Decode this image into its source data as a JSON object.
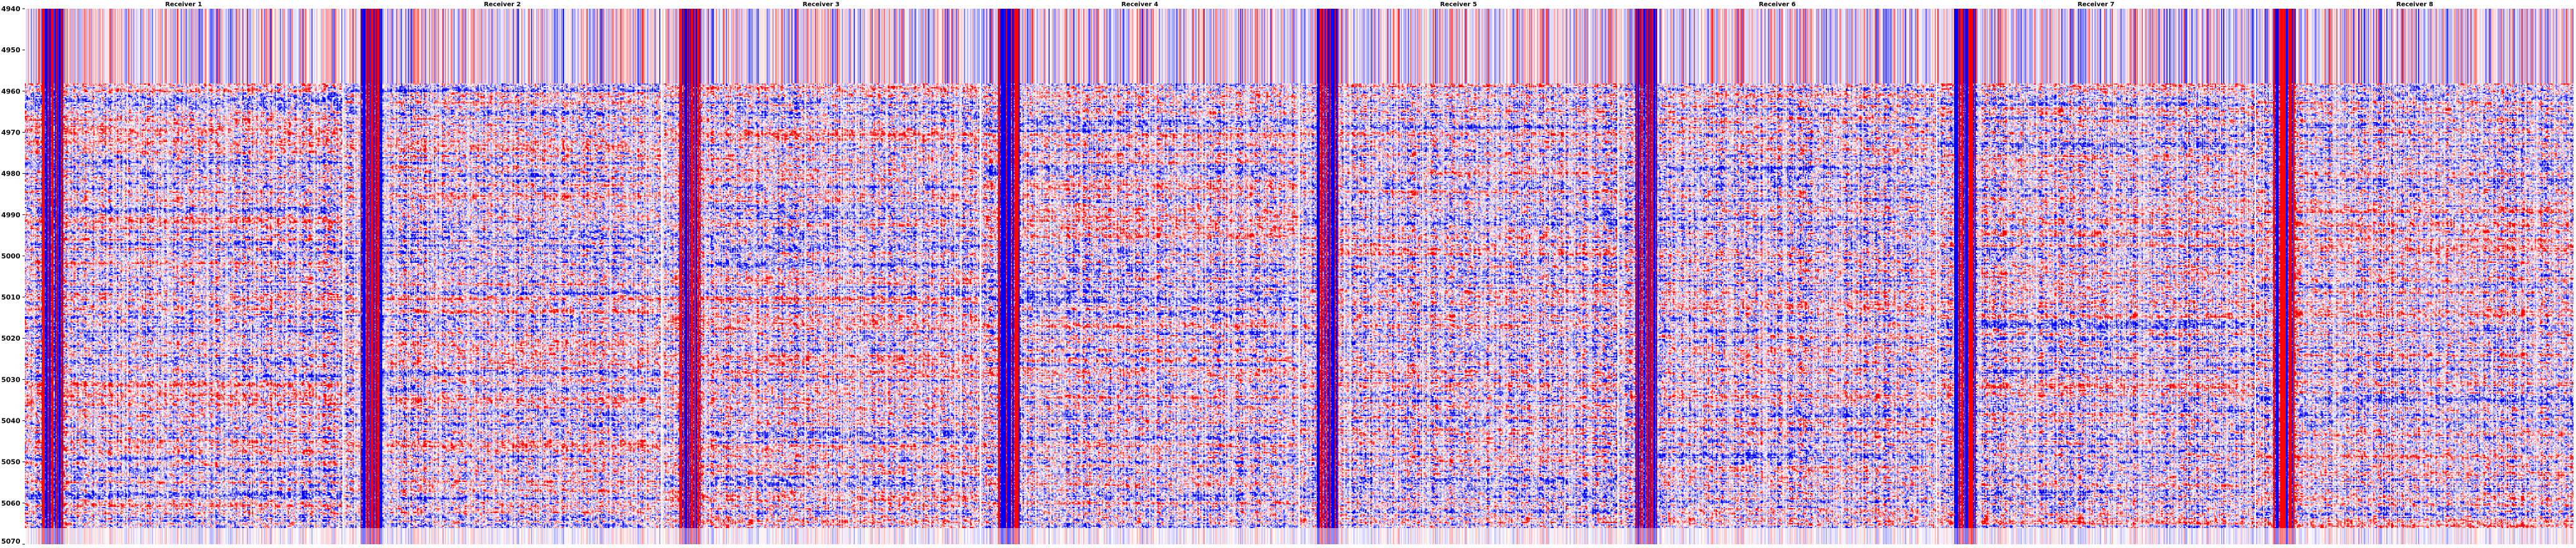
{
  "chart_data": {
    "type": "heatmap",
    "title": "",
    "xlabel": "",
    "ylabel": "",
    "panels": [
      {
        "name": "Receiver 1"
      },
      {
        "name": "Receiver 2"
      },
      {
        "name": "Receiver 3"
      },
      {
        "name": "Receiver 4"
      },
      {
        "name": "Receiver 5"
      },
      {
        "name": "Receiver 6"
      },
      {
        "name": "Receiver 7"
      },
      {
        "name": "Receiver 8"
      }
    ],
    "y_ticks": [
      4940,
      4950,
      4960,
      4970,
      4980,
      4990,
      5000,
      5010,
      5020,
      5030,
      5040,
      5050,
      5060,
      5070
    ],
    "ylim": [
      4940,
      5070
    ],
    "y_inverted": true,
    "traces_per_panel": 320,
    "colormap": "seismic (blue-white-red)",
    "grid": false,
    "legend": "none"
  },
  "colors": {
    "negative": "#0000ff",
    "zero": "#ffffff",
    "positive": "#ff0000",
    "text": "#000000"
  }
}
